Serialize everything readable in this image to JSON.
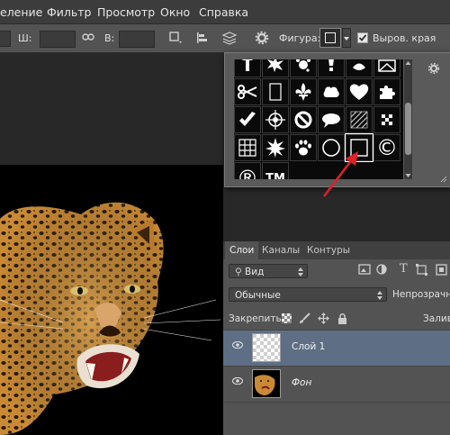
{
  "menubar": {
    "items": [
      "еление",
      "Фильтр",
      "Просмотр",
      "Окно",
      "Справка"
    ]
  },
  "options": {
    "width_label": "Ш:",
    "height_label": "В:",
    "shape_label": "Фигура:",
    "align_edges_label": "Выров. края",
    "align_edges_checked": true
  },
  "layers_panel": {
    "tabs": [
      "Слои",
      "Каналы",
      "Контуры"
    ],
    "active_tab": "Слои",
    "filter_value": "Вид",
    "blend_mode": "Обычные",
    "opacity_label": "Непрозрачност",
    "lock_label": "Закрепить:",
    "fill_label": "Залив",
    "layers": [
      {
        "name": "Слой 1",
        "selected": true
      },
      {
        "name": "Фон",
        "selected": false,
        "italic": true
      }
    ]
  },
  "shapes": {
    "selected": "square-outline",
    "row1": [
      "arrow",
      "burst",
      "splat",
      "lamp",
      "ornament",
      "envelope"
    ],
    "row2": [
      "scissors",
      "blank-page",
      "fleur-de-lis",
      "puzzle-bird",
      "heart",
      "puzzle"
    ],
    "row3": [
      "checkmark",
      "target",
      "no-sign",
      "speech-bubble",
      "hatched-square",
      "checkerboard"
    ],
    "row4": [
      "grid",
      "starburst",
      "paw",
      "circle-outline",
      "square-outline",
      "copyright"
    ],
    "row5": [
      "registered",
      "trademark"
    ],
    "copyright_glyph": "©",
    "registered_glyph": "®",
    "trademark_glyph": "TM"
  },
  "colors": {
    "accent_arrow": "#e0202a",
    "selected_layer": "#5e6e84",
    "panel": "#535353"
  }
}
